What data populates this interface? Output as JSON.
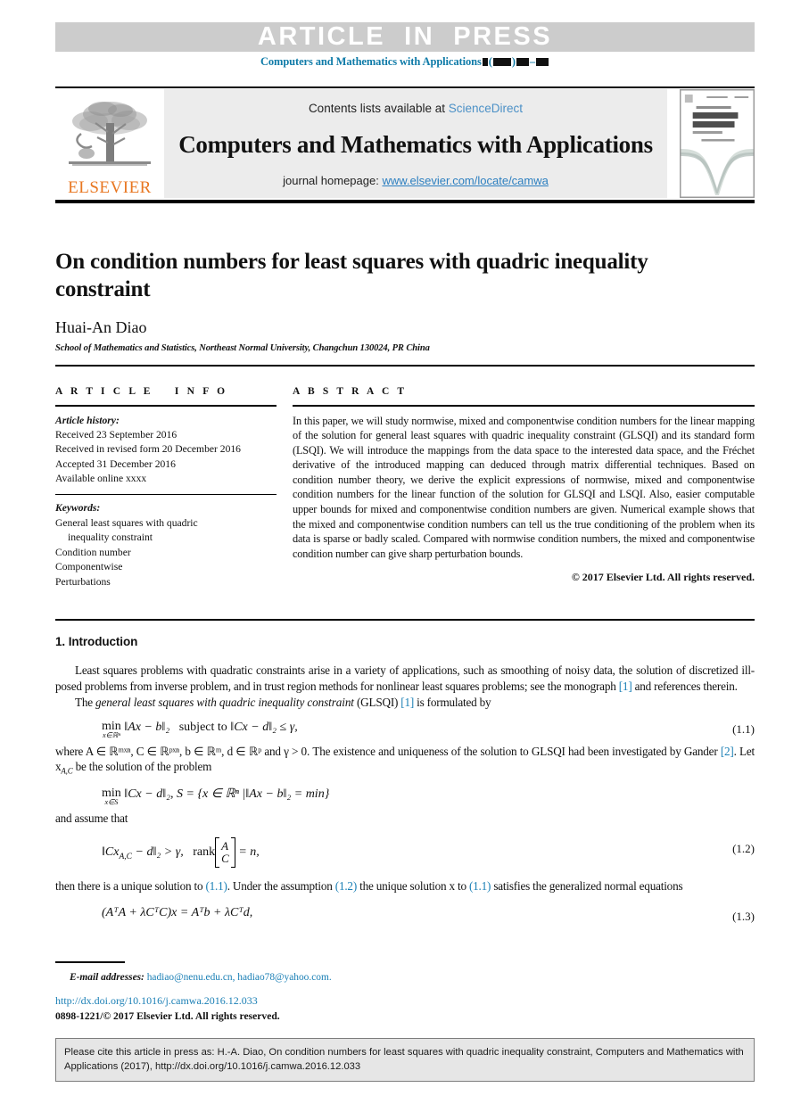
{
  "banner": {
    "text": "ARTICLE  IN  PRESS"
  },
  "running_head": {
    "journal": "Computers and Mathematics with Applications",
    "volume_placeholder": "■",
    "issue_placeholder": "■■■",
    "pages_placeholder": "■■–■■"
  },
  "masthead": {
    "publisher": "ELSEVIER",
    "publisher_logo_icon": "elsevier-tree-icon",
    "contents_prefix": "Contents lists available at ",
    "contents_link": "ScienceDirect",
    "journal_title": "Computers and Mathematics with Applications",
    "homepage_prefix": "journal homepage: ",
    "homepage_url": "www.elsevier.com/locate/camwa",
    "cover": {
      "line1": "An International Journal",
      "line2": "computers &",
      "line3": "mathematics",
      "line4": "with applications",
      "line5": "Editor-in-Chief:  Ervin Y. Rodin"
    }
  },
  "article": {
    "title": "On condition numbers for least squares with quadric inequality constraint",
    "author": "Huai-An Diao",
    "affiliation": "School of Mathematics and Statistics, Northeast Normal University, Changchun 130024, PR China"
  },
  "info": {
    "heading": "A R T I C L E    I N F O",
    "history_label": "Article history:",
    "history": [
      "Received 23 September 2016",
      "Received in revised form 20 December 2016",
      "Accepted 31 December 2016",
      "Available online xxxx"
    ],
    "keywords_label": "Keywords:",
    "keywords": [
      "General least squares with quadric",
      "inequality constraint",
      "Condition number",
      "Componentwise",
      "Perturbations"
    ]
  },
  "abstract": {
    "heading": "A B S T R A C T",
    "text": "In this paper, we will study normwise, mixed and componentwise condition numbers for the linear mapping of the solution for general least squares with quadric inequality constraint (GLSQI) and its standard form (LSQI). We will introduce the mappings from the data space to the interested data space, and the Fréchet derivative of the introduced mapping can deduced through matrix differential techniques. Based on condition number theory, we derive the explicit expressions of normwise, mixed and componentwise condition numbers for the linear function of the solution for GLSQI and LSQI. Also, easier computable upper bounds for mixed and componentwise condition numbers are given. Numerical example shows that the mixed and componentwise condition numbers can tell us the true conditioning of the problem when its data is sparse or badly scaled. Compared with normwise condition numbers, the mixed and componentwise condition number can give sharp perturbation bounds.",
    "copyright": "© 2017 Elsevier Ltd. All rights reserved."
  },
  "introduction": {
    "heading": "1. Introduction",
    "para1_a": "Least squares problems with quadratic constraints arise in a variety of applications, such as smoothing of noisy data, the solution of discretized ill-posed problems from inverse problem, and in trust region methods for nonlinear least squares problems; see the monograph ",
    "para1_ref": "[1]",
    "para1_b": " and references therein.",
    "para2_a": "The ",
    "para2_italic": "general least squares with quadric inequality constraint",
    "para2_b": " (GLSQI) ",
    "para2_ref": "[1]",
    "para2_c": " is formulated by",
    "eq11_number": "(1.1)",
    "eq11_min": "min",
    "eq11_under": "x∈ℝⁿ",
    "eq11_objective": "‖Ax − b‖₂",
    "eq11_subject": "subject to",
    "eq11_constraint": "‖Cx − d‖₂ ≤ γ,",
    "para3": "where A ∈ ℝᵐˣⁿ, C ∈ ℝᵖˣⁿ, b ∈ ℝᵐ, d ∈ ℝᵖ and γ > 0. The existence and uniqueness of the solution to GLSQI had been investigated by Gander ",
    "para3_ref": "[2]",
    "para3_b": ". Let x",
    "para3_sub": "A,C",
    "para3_c": " be the solution of the problem",
    "eqS_min": "min",
    "eqS_under": "x∈S",
    "eqS_body": "‖Cx − d‖₂,    S = {x ∈ ℝⁿ |‖Ax − b‖₂ = min}",
    "para4": "and assume that",
    "eq12_number": "(1.2)",
    "eq12_lhs": "‖Cx",
    "eq12_sub": "A,C",
    "eq12_mid": " − d‖₂ > γ,",
    "eq12_rank": "rank",
    "eq12_matrix_top": "A",
    "eq12_matrix_bottom": "C",
    "eq12_rhs": "= n,",
    "para5_a": "then there is a unique solution to ",
    "para5_ref1": "(1.1)",
    "para5_b": ". Under the assumption ",
    "para5_ref2": "(1.2)",
    "para5_c": " the unique solution x to ",
    "para5_ref3": "(1.1)",
    "para5_d": " satisfies the generalized normal equations",
    "eq13_number": "(1.3)",
    "eq13_body": "(AᵀA + λCᵀC)x = Aᵀb + λCᵀd,"
  },
  "footer": {
    "email_label": "E-mail addresses:",
    "emails": "hadiao@nenu.edu.cn, hadiao78@yahoo.com.",
    "doi": "http://dx.doi.org/10.1016/j.camwa.2016.12.033",
    "issn_line": "0898-1221/© 2017 Elsevier Ltd. All rights reserved.",
    "cite_notice": "Please cite this article in press as: H.-A. Diao, On condition numbers for least squares with quadric inequality constraint, Computers and Mathematics with Applications (2017), http://dx.doi.org/10.1016/j.camwa.2016.12.033"
  },
  "colors": {
    "banner_grey": "#cccccc",
    "link_blue": "#1a7fb5",
    "sciencedirect_blue": "#4b90c6",
    "elsevier_orange": "#e87722",
    "masthead_grey": "#ececec",
    "cite_box_grey": "#e6e6e6"
  }
}
